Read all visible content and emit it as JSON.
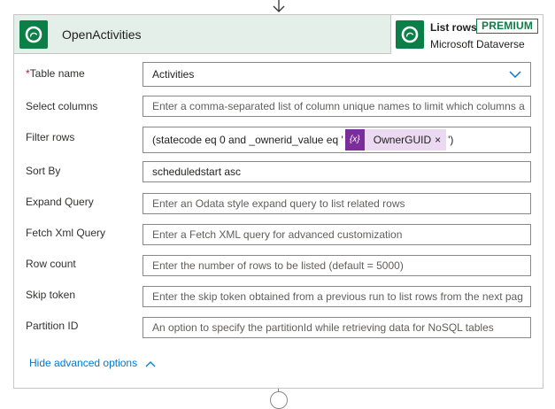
{
  "step": {
    "title": "OpenActivities",
    "icon": "dataverse-icon",
    "accent": "#0b7f48",
    "header_bg": "#e3efe8"
  },
  "action": {
    "name": "List rows",
    "badge": "PREMIUM",
    "connector": "Microsoft Dataverse"
  },
  "fields": {
    "table_name": {
      "label": "Table name",
      "required": "*",
      "value": "Activities"
    },
    "select_columns": {
      "label": "Select columns",
      "placeholder": "Enter a comma-separated list of column unique names to limit which columns a"
    },
    "filter_rows": {
      "label": "Filter rows",
      "prefix": "(statecode eq 0 and _ownerid_value eq '",
      "token_icon": "{x}",
      "token_label": "OwnerGUID",
      "token_close": "×",
      "suffix": "')"
    },
    "sort_by": {
      "label": "Sort By",
      "value": "scheduledstart asc"
    },
    "expand_query": {
      "label": "Expand Query",
      "placeholder": "Enter an Odata style expand query to list related rows"
    },
    "fetch_xml": {
      "label": "Fetch Xml Query",
      "placeholder": "Enter a Fetch XML query for advanced customization"
    },
    "row_count": {
      "label": "Row count",
      "placeholder": "Enter the number of rows to be listed (default = 5000)"
    },
    "skip_token": {
      "label": "Skip token",
      "placeholder": "Enter the skip token obtained from a previous run to list rows from the next pag"
    },
    "partition_id": {
      "label": "Partition ID",
      "placeholder": "An option to specify the partitionId while retrieving data for NoSQL tables"
    }
  },
  "advanced_toggle": {
    "label": "Hide advanced options"
  },
  "colors": {
    "link": "#0078d4",
    "token_bg": "#ead9f0",
    "token_icon_bg": "#7a2d9b",
    "required": "#a4262c"
  }
}
